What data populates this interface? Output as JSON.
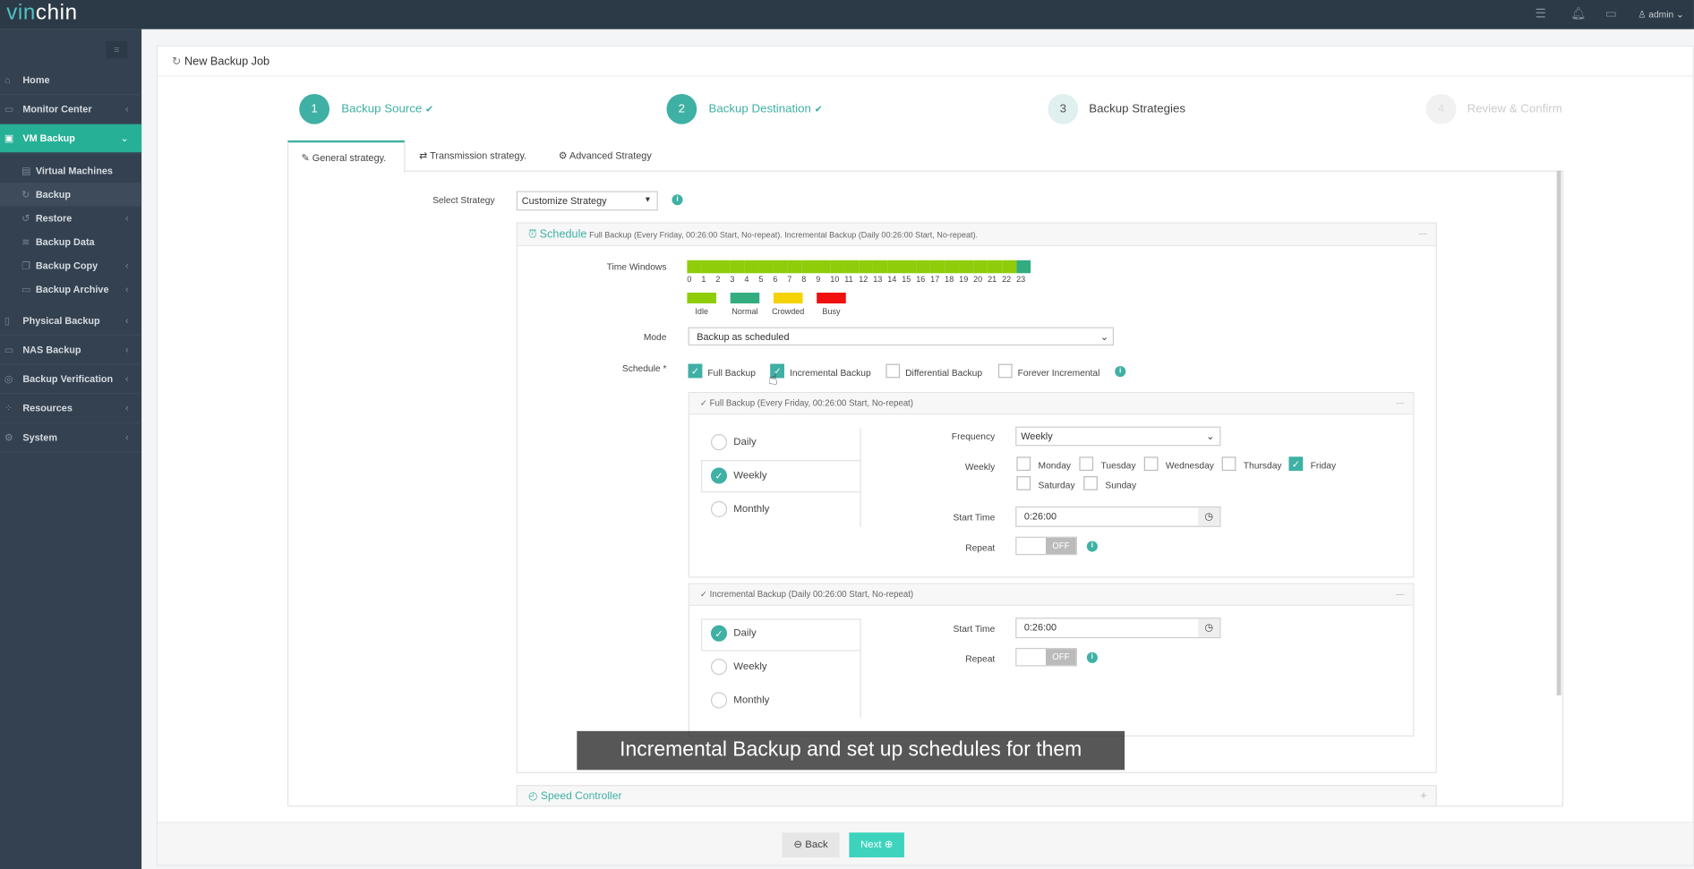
{
  "app": {
    "logo": "vinchin",
    "user": "admin"
  },
  "topbar": {
    "icons": [
      "list-icon",
      "bell-icon",
      "monitor-icon",
      "user-icon"
    ]
  },
  "sidebar": {
    "items": [
      {
        "label": "Home",
        "icon": "home-icon"
      },
      {
        "label": "Monitor Center",
        "icon": "monitor-icon"
      },
      {
        "label": "VM Backup",
        "icon": "vm-icon",
        "active": true
      },
      {
        "label": "Physical Backup",
        "icon": "server-icon"
      },
      {
        "label": "NAS Backup",
        "icon": "nas-icon"
      },
      {
        "label": "Backup Verification",
        "icon": "verify-icon"
      },
      {
        "label": "Resources",
        "icon": "resources-icon"
      },
      {
        "label": "System",
        "icon": "gear-icon"
      }
    ],
    "subitems": [
      {
        "label": "Virtual Machines"
      },
      {
        "label": "Backup",
        "active": true
      },
      {
        "label": "Restore"
      },
      {
        "label": "Backup Data"
      },
      {
        "label": "Backup Copy"
      },
      {
        "label": "Backup Archive"
      }
    ]
  },
  "page": {
    "title": "New Backup Job"
  },
  "steps": [
    {
      "num": "1",
      "label": "Backup Source",
      "done": true
    },
    {
      "num": "2",
      "label": "Backup Destination",
      "done": true
    },
    {
      "num": "3",
      "label": "Backup Strategies"
    },
    {
      "num": "4",
      "label": "Review & Confirm"
    }
  ],
  "tabs": [
    {
      "label": "General strategy.",
      "active": true
    },
    {
      "label": "Transmission strategy."
    },
    {
      "label": "Advanced Strategy"
    }
  ],
  "strategy": {
    "label": "Select Strategy",
    "value": "Customize Strategy"
  },
  "schedule": {
    "title": "Schedule",
    "summary": "Full Backup (Every Friday, 00:26:00 Start, No-repeat). Incremental Backup (Daily 00:26:00 Start, No-repeat).",
    "time_windows_label": "Time Windows",
    "hours": [
      "0",
      "1",
      "2",
      "3",
      "4",
      "5",
      "6",
      "7",
      "8",
      "9",
      "10",
      "11",
      "12",
      "13",
      "14",
      "15",
      "16",
      "17",
      "18",
      "19",
      "20",
      "21",
      "22",
      "23"
    ],
    "hour_levels": [
      "Idle",
      "Idle",
      "Idle",
      "Idle",
      "Idle",
      "Idle",
      "Idle",
      "Idle",
      "Idle",
      "Idle",
      "Idle",
      "Idle",
      "Idle",
      "Idle",
      "Idle",
      "Idle",
      "Idle",
      "Idle",
      "Idle",
      "Idle",
      "Idle",
      "Idle",
      "Idle",
      "Normal"
    ],
    "legend": [
      {
        "label": "Idle",
        "color": "#8fcc0a"
      },
      {
        "label": "Normal",
        "color": "#33ad7f"
      },
      {
        "label": "Crowded",
        "color": "#f5d300"
      },
      {
        "label": "Busy",
        "color": "#f01010"
      }
    ],
    "mode_label": "Mode",
    "mode_value": "Backup as scheduled",
    "schedule_label": "Schedule *",
    "types": [
      {
        "label": "Full Backup",
        "checked": true
      },
      {
        "label": "Incremental Backup",
        "checked": true
      },
      {
        "label": "Differential Backup",
        "checked": false
      },
      {
        "label": "Forever Incremental",
        "checked": false
      }
    ]
  },
  "full": {
    "title": "Full Backup (Every Friday, 00:26:00 Start, No-repeat)",
    "options": [
      "Daily",
      "Weekly",
      "Monthly"
    ],
    "selected": "Weekly",
    "frequency_label": "Frequency",
    "frequency": "Weekly",
    "weekly_label": "Weekly",
    "days": [
      {
        "label": "Monday",
        "checked": false
      },
      {
        "label": "Tuesday",
        "checked": false
      },
      {
        "label": "Wednesday",
        "checked": false
      },
      {
        "label": "Thursday",
        "checked": false
      },
      {
        "label": "Friday",
        "checked": true
      },
      {
        "label": "Saturday",
        "checked": false
      },
      {
        "label": "Sunday",
        "checked": false
      }
    ],
    "start_label": "Start Time",
    "start": "0:26:00",
    "repeat_label": "Repeat",
    "repeat": "OFF"
  },
  "incr": {
    "title": "Incremental Backup (Daily 00:26:00 Start, No-repeat)",
    "options": [
      "Daily",
      "Weekly",
      "Monthly"
    ],
    "selected": "Daily",
    "start_label": "Start Time",
    "start": "0:26:00",
    "repeat_label": "Repeat",
    "repeat": "OFF"
  },
  "speed": {
    "title": "Speed Controller"
  },
  "caption": "Incremental Backup and set up schedules for them",
  "footer": {
    "back": "Back",
    "next": "Next"
  }
}
